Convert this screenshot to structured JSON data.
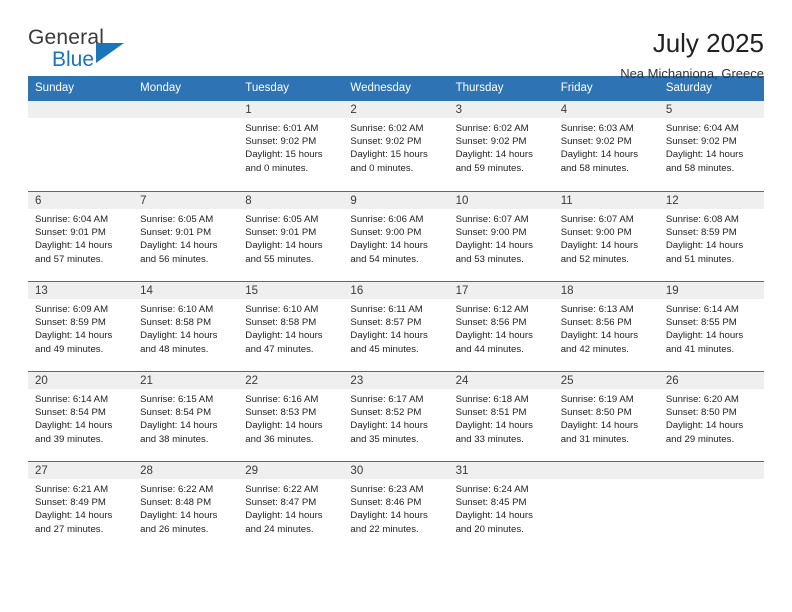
{
  "logo": {
    "word_one": "General",
    "word_two": "Blue",
    "triangle_icon": "triangle-icon",
    "accent_color": "#1b75bb"
  },
  "header": {
    "title": "July 2025",
    "subtitle": "Nea Michaniona, Greece"
  },
  "theme": {
    "header_blue": "#2e74b5",
    "daynum_gray": "#efefef"
  },
  "calendar": {
    "weekdays": [
      "Sunday",
      "Monday",
      "Tuesday",
      "Wednesday",
      "Thursday",
      "Friday",
      "Saturday"
    ],
    "weeks": [
      [
        {
          "day": "",
          "sunrise": "",
          "sunset": "",
          "daylight_1": "",
          "daylight_2": ""
        },
        {
          "day": "",
          "sunrise": "",
          "sunset": "",
          "daylight_1": "",
          "daylight_2": ""
        },
        {
          "day": "1",
          "sunrise": "Sunrise: 6:01 AM",
          "sunset": "Sunset: 9:02 PM",
          "daylight_1": "Daylight: 15 hours",
          "daylight_2": "and 0 minutes."
        },
        {
          "day": "2",
          "sunrise": "Sunrise: 6:02 AM",
          "sunset": "Sunset: 9:02 PM",
          "daylight_1": "Daylight: 15 hours",
          "daylight_2": "and 0 minutes."
        },
        {
          "day": "3",
          "sunrise": "Sunrise: 6:02 AM",
          "sunset": "Sunset: 9:02 PM",
          "daylight_1": "Daylight: 14 hours",
          "daylight_2": "and 59 minutes."
        },
        {
          "day": "4",
          "sunrise": "Sunrise: 6:03 AM",
          "sunset": "Sunset: 9:02 PM",
          "daylight_1": "Daylight: 14 hours",
          "daylight_2": "and 58 minutes."
        },
        {
          "day": "5",
          "sunrise": "Sunrise: 6:04 AM",
          "sunset": "Sunset: 9:02 PM",
          "daylight_1": "Daylight: 14 hours",
          "daylight_2": "and 58 minutes."
        }
      ],
      [
        {
          "day": "6",
          "sunrise": "Sunrise: 6:04 AM",
          "sunset": "Sunset: 9:01 PM",
          "daylight_1": "Daylight: 14 hours",
          "daylight_2": "and 57 minutes."
        },
        {
          "day": "7",
          "sunrise": "Sunrise: 6:05 AM",
          "sunset": "Sunset: 9:01 PM",
          "daylight_1": "Daylight: 14 hours",
          "daylight_2": "and 56 minutes."
        },
        {
          "day": "8",
          "sunrise": "Sunrise: 6:05 AM",
          "sunset": "Sunset: 9:01 PM",
          "daylight_1": "Daylight: 14 hours",
          "daylight_2": "and 55 minutes."
        },
        {
          "day": "9",
          "sunrise": "Sunrise: 6:06 AM",
          "sunset": "Sunset: 9:00 PM",
          "daylight_1": "Daylight: 14 hours",
          "daylight_2": "and 54 minutes."
        },
        {
          "day": "10",
          "sunrise": "Sunrise: 6:07 AM",
          "sunset": "Sunset: 9:00 PM",
          "daylight_1": "Daylight: 14 hours",
          "daylight_2": "and 53 minutes."
        },
        {
          "day": "11",
          "sunrise": "Sunrise: 6:07 AM",
          "sunset": "Sunset: 9:00 PM",
          "daylight_1": "Daylight: 14 hours",
          "daylight_2": "and 52 minutes."
        },
        {
          "day": "12",
          "sunrise": "Sunrise: 6:08 AM",
          "sunset": "Sunset: 8:59 PM",
          "daylight_1": "Daylight: 14 hours",
          "daylight_2": "and 51 minutes."
        }
      ],
      [
        {
          "day": "13",
          "sunrise": "Sunrise: 6:09 AM",
          "sunset": "Sunset: 8:59 PM",
          "daylight_1": "Daylight: 14 hours",
          "daylight_2": "and 49 minutes."
        },
        {
          "day": "14",
          "sunrise": "Sunrise: 6:10 AM",
          "sunset": "Sunset: 8:58 PM",
          "daylight_1": "Daylight: 14 hours",
          "daylight_2": "and 48 minutes."
        },
        {
          "day": "15",
          "sunrise": "Sunrise: 6:10 AM",
          "sunset": "Sunset: 8:58 PM",
          "daylight_1": "Daylight: 14 hours",
          "daylight_2": "and 47 minutes."
        },
        {
          "day": "16",
          "sunrise": "Sunrise: 6:11 AM",
          "sunset": "Sunset: 8:57 PM",
          "daylight_1": "Daylight: 14 hours",
          "daylight_2": "and 45 minutes."
        },
        {
          "day": "17",
          "sunrise": "Sunrise: 6:12 AM",
          "sunset": "Sunset: 8:56 PM",
          "daylight_1": "Daylight: 14 hours",
          "daylight_2": "and 44 minutes."
        },
        {
          "day": "18",
          "sunrise": "Sunrise: 6:13 AM",
          "sunset": "Sunset: 8:56 PM",
          "daylight_1": "Daylight: 14 hours",
          "daylight_2": "and 42 minutes."
        },
        {
          "day": "19",
          "sunrise": "Sunrise: 6:14 AM",
          "sunset": "Sunset: 8:55 PM",
          "daylight_1": "Daylight: 14 hours",
          "daylight_2": "and 41 minutes."
        }
      ],
      [
        {
          "day": "20",
          "sunrise": "Sunrise: 6:14 AM",
          "sunset": "Sunset: 8:54 PM",
          "daylight_1": "Daylight: 14 hours",
          "daylight_2": "and 39 minutes."
        },
        {
          "day": "21",
          "sunrise": "Sunrise: 6:15 AM",
          "sunset": "Sunset: 8:54 PM",
          "daylight_1": "Daylight: 14 hours",
          "daylight_2": "and 38 minutes."
        },
        {
          "day": "22",
          "sunrise": "Sunrise: 6:16 AM",
          "sunset": "Sunset: 8:53 PM",
          "daylight_1": "Daylight: 14 hours",
          "daylight_2": "and 36 minutes."
        },
        {
          "day": "23",
          "sunrise": "Sunrise: 6:17 AM",
          "sunset": "Sunset: 8:52 PM",
          "daylight_1": "Daylight: 14 hours",
          "daylight_2": "and 35 minutes."
        },
        {
          "day": "24",
          "sunrise": "Sunrise: 6:18 AM",
          "sunset": "Sunset: 8:51 PM",
          "daylight_1": "Daylight: 14 hours",
          "daylight_2": "and 33 minutes."
        },
        {
          "day": "25",
          "sunrise": "Sunrise: 6:19 AM",
          "sunset": "Sunset: 8:50 PM",
          "daylight_1": "Daylight: 14 hours",
          "daylight_2": "and 31 minutes."
        },
        {
          "day": "26",
          "sunrise": "Sunrise: 6:20 AM",
          "sunset": "Sunset: 8:50 PM",
          "daylight_1": "Daylight: 14 hours",
          "daylight_2": "and 29 minutes."
        }
      ],
      [
        {
          "day": "27",
          "sunrise": "Sunrise: 6:21 AM",
          "sunset": "Sunset: 8:49 PM",
          "daylight_1": "Daylight: 14 hours",
          "daylight_2": "and 27 minutes."
        },
        {
          "day": "28",
          "sunrise": "Sunrise: 6:22 AM",
          "sunset": "Sunset: 8:48 PM",
          "daylight_1": "Daylight: 14 hours",
          "daylight_2": "and 26 minutes."
        },
        {
          "day": "29",
          "sunrise": "Sunrise: 6:22 AM",
          "sunset": "Sunset: 8:47 PM",
          "daylight_1": "Daylight: 14 hours",
          "daylight_2": "and 24 minutes."
        },
        {
          "day": "30",
          "sunrise": "Sunrise: 6:23 AM",
          "sunset": "Sunset: 8:46 PM",
          "daylight_1": "Daylight: 14 hours",
          "daylight_2": "and 22 minutes."
        },
        {
          "day": "31",
          "sunrise": "Sunrise: 6:24 AM",
          "sunset": "Sunset: 8:45 PM",
          "daylight_1": "Daylight: 14 hours",
          "daylight_2": "and 20 minutes."
        },
        {
          "day": "",
          "sunrise": "",
          "sunset": "",
          "daylight_1": "",
          "daylight_2": ""
        },
        {
          "day": "",
          "sunrise": "",
          "sunset": "",
          "daylight_1": "",
          "daylight_2": ""
        }
      ]
    ]
  }
}
